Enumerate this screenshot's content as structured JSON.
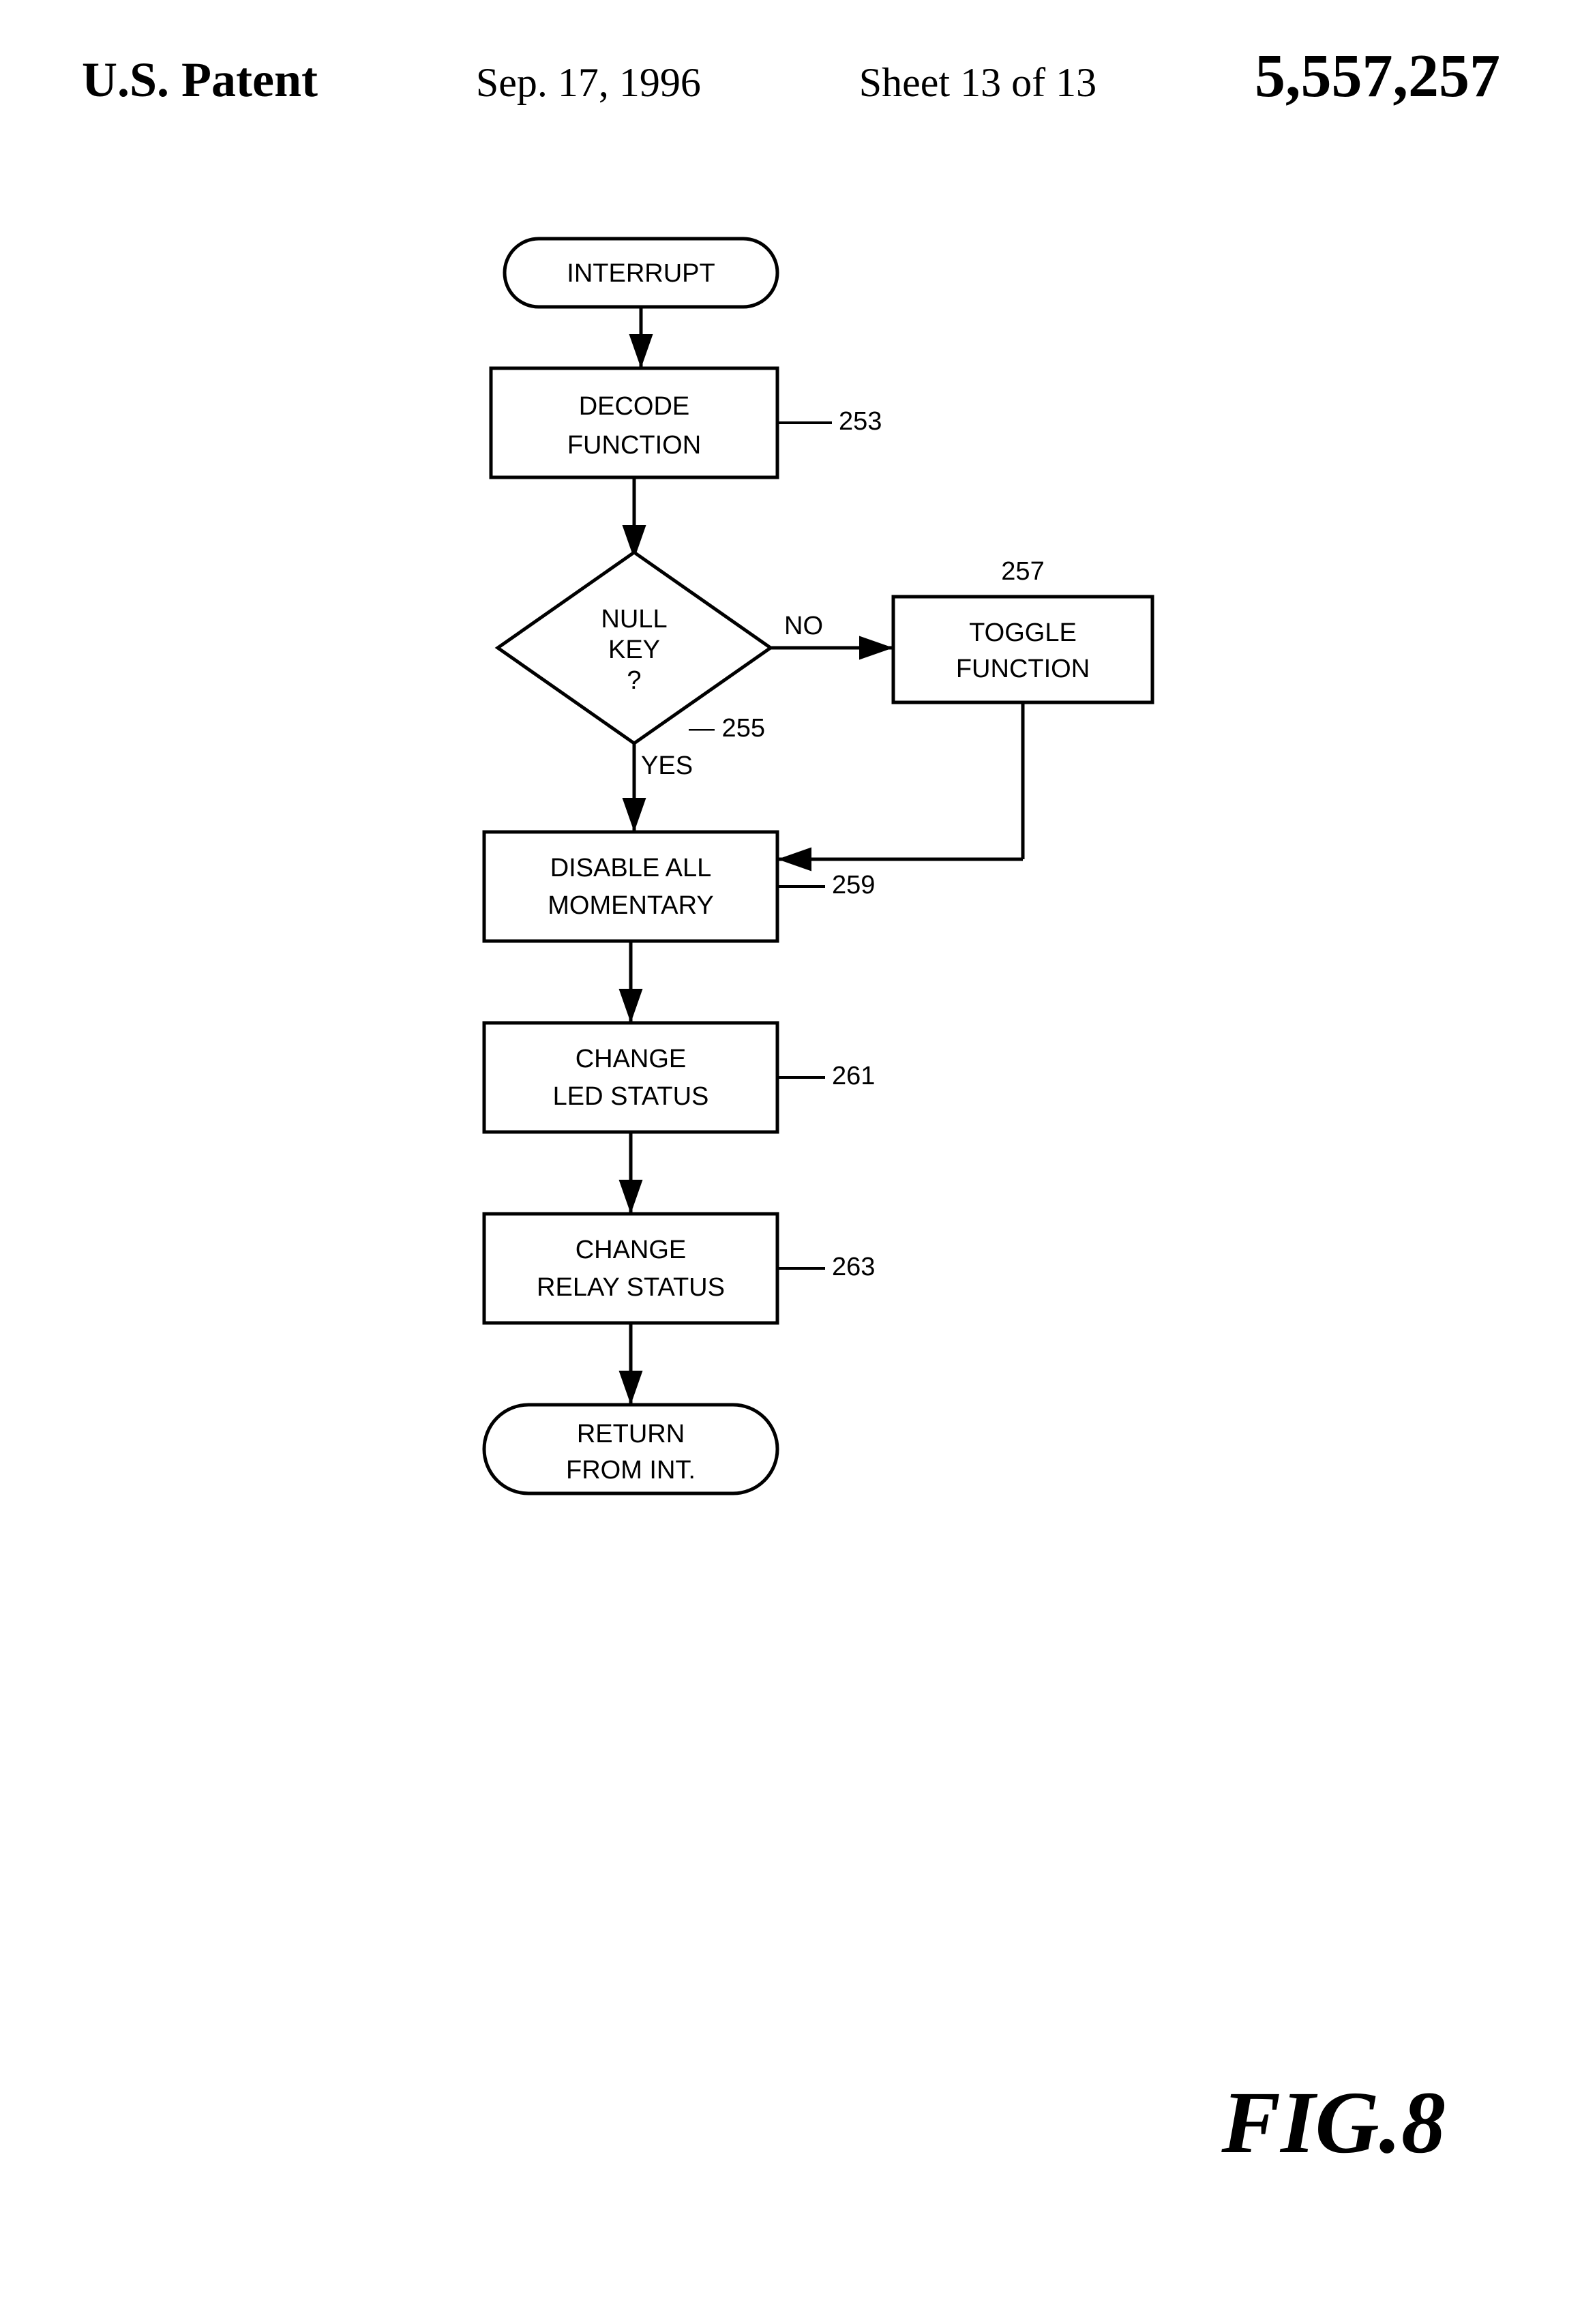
{
  "header": {
    "patent_label": "U.S. Patent",
    "date": "Sep. 17, 1996",
    "sheet": "Sheet 13 of 13",
    "patent_number": "5,557,257"
  },
  "flowchart": {
    "nodes": [
      {
        "id": "interrupt",
        "label": "INTERRUPT",
        "type": "terminal"
      },
      {
        "id": "decode",
        "label": "DECODE\nFUNCTION",
        "type": "process",
        "ref": "253"
      },
      {
        "id": "null_key",
        "label": "NULL\nKEY\n?",
        "type": "decision"
      },
      {
        "id": "toggle",
        "label": "TOGGLE\nFUNCTION",
        "type": "process",
        "ref": "257"
      },
      {
        "id": "disable",
        "label": "DISABLE ALL\nMOMENTARY",
        "type": "process",
        "ref": "259"
      },
      {
        "id": "change_led",
        "label": "CHANGE\nLED STATUS",
        "type": "process",
        "ref": "261"
      },
      {
        "id": "change_relay",
        "label": "CHANGE\nRELAY STATUS",
        "type": "process",
        "ref": "263"
      },
      {
        "id": "return",
        "label": "RETURN\nFROM INT.",
        "type": "terminal"
      }
    ],
    "connections": [
      {
        "from": "interrupt",
        "to": "decode"
      },
      {
        "from": "decode",
        "to": "null_key"
      },
      {
        "from": "null_key",
        "to": "toggle",
        "label": "NO"
      },
      {
        "from": "null_key",
        "to": "disable",
        "label": "YES"
      },
      {
        "from": "toggle",
        "to": "disable"
      },
      {
        "from": "disable",
        "to": "change_led"
      },
      {
        "from": "change_led",
        "to": "change_relay"
      },
      {
        "from": "change_relay",
        "to": "return"
      }
    ]
  },
  "figure_label": "FIG.8"
}
